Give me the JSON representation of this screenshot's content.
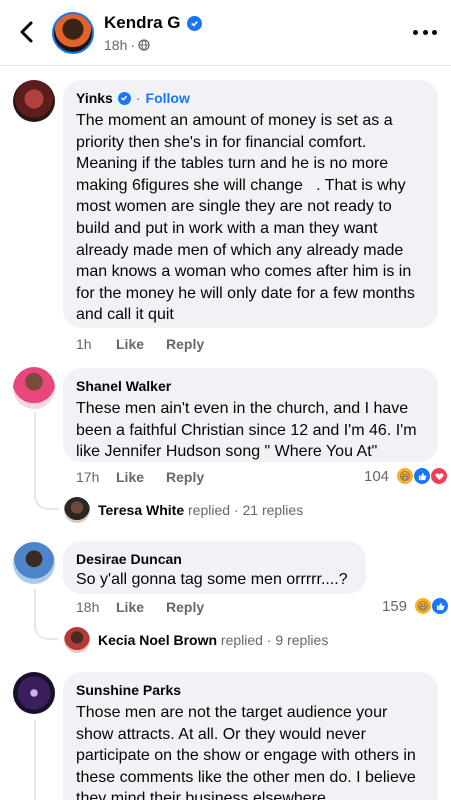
{
  "header": {
    "name": "Kendra G",
    "time": "18h",
    "back_icon": "chevron-left-icon",
    "more_icon": "more-horizontal-icon",
    "audience_icon": "globe-icon"
  },
  "comments": [
    {
      "name": "Yinks",
      "verified": true,
      "follow_label": "Follow",
      "text": "The moment an amount of money is set as a priority then she's in for financial comfort. Meaning if the tables turn and he is no more making 6figures she will change   . That is why most women are single they are not ready to build and put in work with a man they want already made men of which any already made man knows a woman who comes after him is in for the money he will only date for a few months and call it quit",
      "time": "1h",
      "like_label": "Like",
      "reply_label": "Reply"
    },
    {
      "name": "Shanel Walker",
      "text": "These men ain't even in the church, and I have been a faithful Christian since 12 and I'm 46. I'm like Jennifer Hudson song \" Where You At\"",
      "time": "17h",
      "like_label": "Like",
      "reply_label": "Reply",
      "reaction_count": "104",
      "reply_preview": {
        "name": "Teresa White",
        "action": "replied",
        "sep": "·",
        "count": "21 replies"
      }
    },
    {
      "name": "Desirae Duncan",
      "text": "So y'all gonna tag some men orrrrr....?",
      "time": "18h",
      "like_label": "Like",
      "reply_label": "Reply",
      "reaction_count": "159",
      "reply_preview": {
        "name": "Kecia Noel Brown",
        "action": "replied",
        "sep": "·",
        "count": "9 replies"
      }
    },
    {
      "name": "Sunshine Parks",
      "text": "Those men are not the target audience your show attracts. At all. Or they would never participate on the show or engage with others in these comments like the other men do. I believe they mind their business elsewhere"
    }
  ],
  "colors": {
    "accent": "#1877f2",
    "bubble": "#f0f2f5",
    "meta": "#65676b"
  }
}
